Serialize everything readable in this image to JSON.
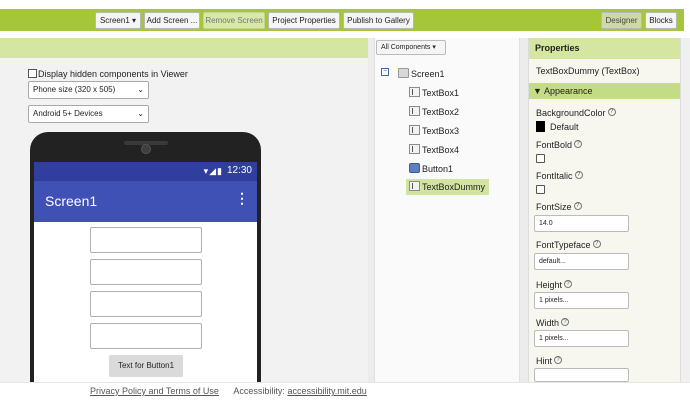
{
  "toolbar": {
    "screen_select": "Screen1",
    "add_screen": "Add Screen ...",
    "remove_screen": "Remove Screen",
    "project_properties": "Project Properties",
    "publish": "Publish to Gallery",
    "designer": "Designer",
    "blocks": "Blocks"
  },
  "viewer": {
    "hidden_label": "Display hidden components in Viewer",
    "size_select": "Phone size (320 x 505)",
    "device_select": "Android 5+ Devices"
  },
  "phone": {
    "time": "12:30",
    "status_icons": "▾◢▮",
    "title": "Screen1",
    "menu_icon": "⋮",
    "button_label": "Text for Button1"
  },
  "tree": {
    "filter": "All Components",
    "toggle": "−",
    "items": [
      {
        "label": "Screen1"
      },
      {
        "label": "TextBox1"
      },
      {
        "label": "TextBox2"
      },
      {
        "label": "TextBox3"
      },
      {
        "label": "TextBox4"
      },
      {
        "label": "Button1"
      },
      {
        "label": "TextBoxDummy"
      }
    ]
  },
  "properties": {
    "header": "Properties",
    "component": "TextBoxDummy (TextBox)",
    "section": "Appearance",
    "background_color_label": "BackgroundColor",
    "background_color_value": "Default",
    "font_bold_label": "FontBold",
    "font_italic_label": "FontItalic",
    "font_size_label": "FontSize",
    "font_size_value": "14.0",
    "font_typeface_label": "FontTypeface",
    "font_typeface_value": "default...",
    "height_label": "Height",
    "height_value": "1 pixels...",
    "width_label": "Width",
    "width_value": "1 pixels...",
    "hint_label": "Hint",
    "help_mark": "?"
  },
  "footer": {
    "privacy": "Privacy Policy and Terms of Use",
    "accessibility_prefix": "Accessibility:",
    "accessibility_link": "accessibility.mit.edu"
  },
  "colors": {
    "toolbar_green": "#a5c638",
    "panel_header": "#d4e6a0",
    "app_bar": "#3f51b5",
    "status_bar": "#303f9f"
  }
}
